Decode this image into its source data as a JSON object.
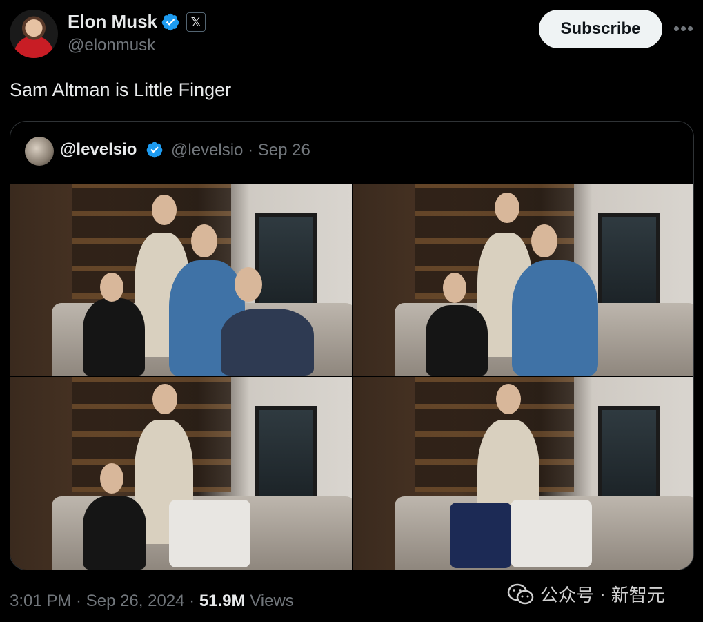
{
  "author": {
    "name": "Elon Musk",
    "handle": "@elonmusk",
    "x_badge": "𝕏"
  },
  "actions": {
    "subscribe_label": "Subscribe",
    "more_label": "•••"
  },
  "tweet": {
    "text": "Sam Altman is Little Finger"
  },
  "quote": {
    "display_name": "@levelsio",
    "meta": "@levelsio · Sep 26",
    "photos": [
      "photo-1",
      "photo-2",
      "photo-3",
      "photo-4"
    ]
  },
  "footer": {
    "timestamp": "3:01 PM · Sep 26, 2024 · ",
    "views_count": "51.9M",
    "views_label": " Views"
  },
  "watermark": {
    "text": "公众号 · 新智元"
  },
  "colors": {
    "background": "#000000",
    "primary_text": "#e7e9ea",
    "secondary_text": "#71767b",
    "verified_blue": "#1d9bf0",
    "border": "#2f3336"
  }
}
